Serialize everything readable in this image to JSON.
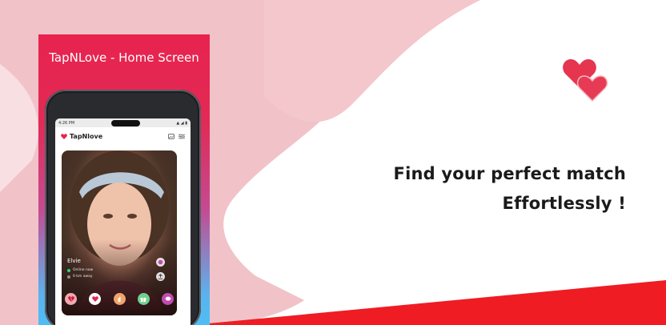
{
  "panel": {
    "title": "TapNLove - Home Screen"
  },
  "phone": {
    "status_time": "4:26 PM",
    "status_right": "▲ ◢ ▮",
    "app_name": "TapNlove",
    "profile": {
      "name": "Elvie",
      "online": "Online now",
      "distance": "0 km away"
    }
  },
  "tagline": {
    "line1": "Find your perfect match",
    "line2": "Effortlessly !"
  },
  "colors": {
    "brand_red": "#e8234e",
    "accent_pink": "#f0c2c8",
    "bottom_red": "#ef1c24"
  },
  "icons": [
    "heart-icon",
    "image-icon",
    "filter-icon",
    "broken-heart-icon",
    "like-heart-icon",
    "pinch-icon",
    "gift-icon",
    "chat-icon",
    "upload-icon"
  ]
}
